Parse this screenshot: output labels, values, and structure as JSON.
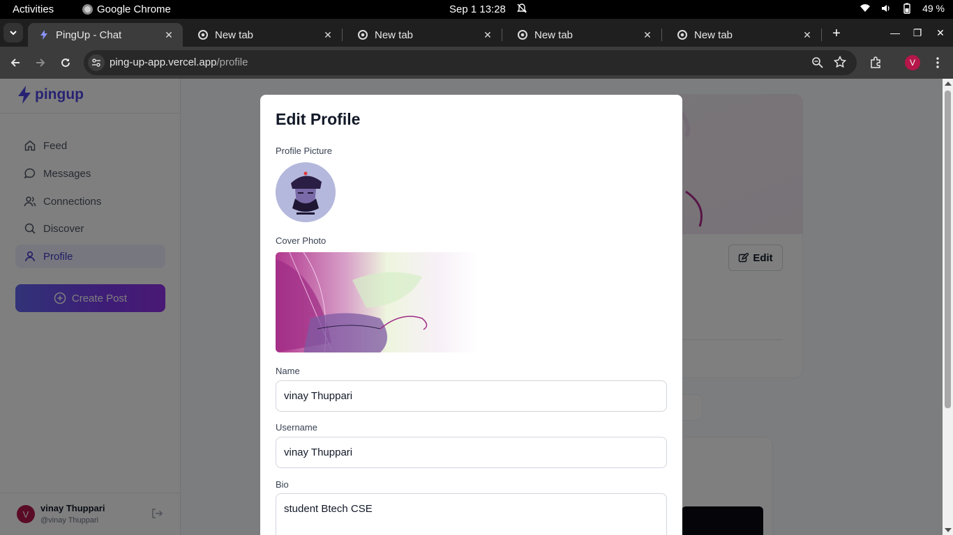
{
  "system": {
    "activities": "Activities",
    "app_name": "Google Chrome",
    "clock": "Sep 1  13:28",
    "battery": "49 %"
  },
  "tabs": [
    {
      "title": "PingUp - Chat",
      "active": true
    },
    {
      "title": "New tab",
      "active": false
    },
    {
      "title": "New tab",
      "active": false
    },
    {
      "title": "New tab",
      "active": false
    },
    {
      "title": "New tab",
      "active": false
    }
  ],
  "omnibox": {
    "domain": "ping-up-app.vercel.app",
    "path": "/profile"
  },
  "profile_avatar_letter": "V",
  "sidebar": {
    "logo": "pingup",
    "nav": [
      {
        "label": "Feed",
        "icon": "home-icon"
      },
      {
        "label": "Messages",
        "icon": "message-icon"
      },
      {
        "label": "Connections",
        "icon": "users-icon"
      },
      {
        "label": "Discover",
        "icon": "search-icon"
      },
      {
        "label": "Profile",
        "icon": "user-icon",
        "active": true
      }
    ],
    "create_post": "Create Post",
    "user": {
      "initial": "V",
      "name": "vinay Thuppari",
      "username": "@vinay Thuppari"
    }
  },
  "background": {
    "edit_label": "Edit"
  },
  "modal": {
    "title": "Edit Profile",
    "profile_picture_label": "Profile Picture",
    "cover_photo_label": "Cover Photo",
    "name_label": "Name",
    "name_value": "vinay Thuppari",
    "username_label": "Username",
    "username_value": "vinay Thuppari",
    "bio_label": "Bio",
    "bio_value": "student Btech CSE"
  },
  "colors": {
    "accent": "#4f46e5",
    "overlay": "rgba(0,0,0,0.5)"
  }
}
